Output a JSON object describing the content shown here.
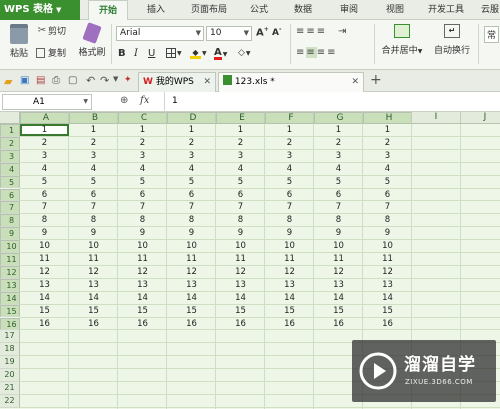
{
  "app": {
    "brand": "WPS 表格",
    "brand_arrow": "▼"
  },
  "menu": {
    "tabs": [
      "开始",
      "插入",
      "页面布局",
      "公式",
      "数据",
      "审阅",
      "视图",
      "开发工具",
      "云服"
    ],
    "active": 0
  },
  "ribbon": {
    "paste": "粘贴",
    "cut": "剪切",
    "copy": "复制",
    "format_painter": "格式刷",
    "font_name": "Arial",
    "font_size": "10",
    "merge_center": "合并居中",
    "auto_wrap": "自动换行",
    "normal": "常"
  },
  "tabs": {
    "items": [
      {
        "label": "我的WPS"
      },
      {
        "label": "123.xls *"
      }
    ],
    "add": "+"
  },
  "formula_bar": {
    "cell_ref": "A1",
    "fx": "fx",
    "value": "1"
  },
  "grid": {
    "columns": [
      "A",
      "B",
      "C",
      "D",
      "E",
      "F",
      "G",
      "H",
      "I",
      "J"
    ],
    "rows": [
      "1",
      "2",
      "3",
      "4",
      "5",
      "6",
      "7",
      "8",
      "9",
      "10",
      "11",
      "12",
      "13",
      "14",
      "15",
      "16",
      "17",
      "18",
      "19",
      "20",
      "21",
      "22"
    ],
    "data_rows": 16,
    "data_cols": 8
  },
  "watermark": {
    "title": "溜溜自学",
    "subtitle": "ZIXUE.3D66.COM"
  },
  "colors": {
    "brand_green": "#3a8f2e",
    "grid_bg": "#eef6e8",
    "header_bg": "#e3ebdd",
    "selection": "#c9dfba"
  }
}
